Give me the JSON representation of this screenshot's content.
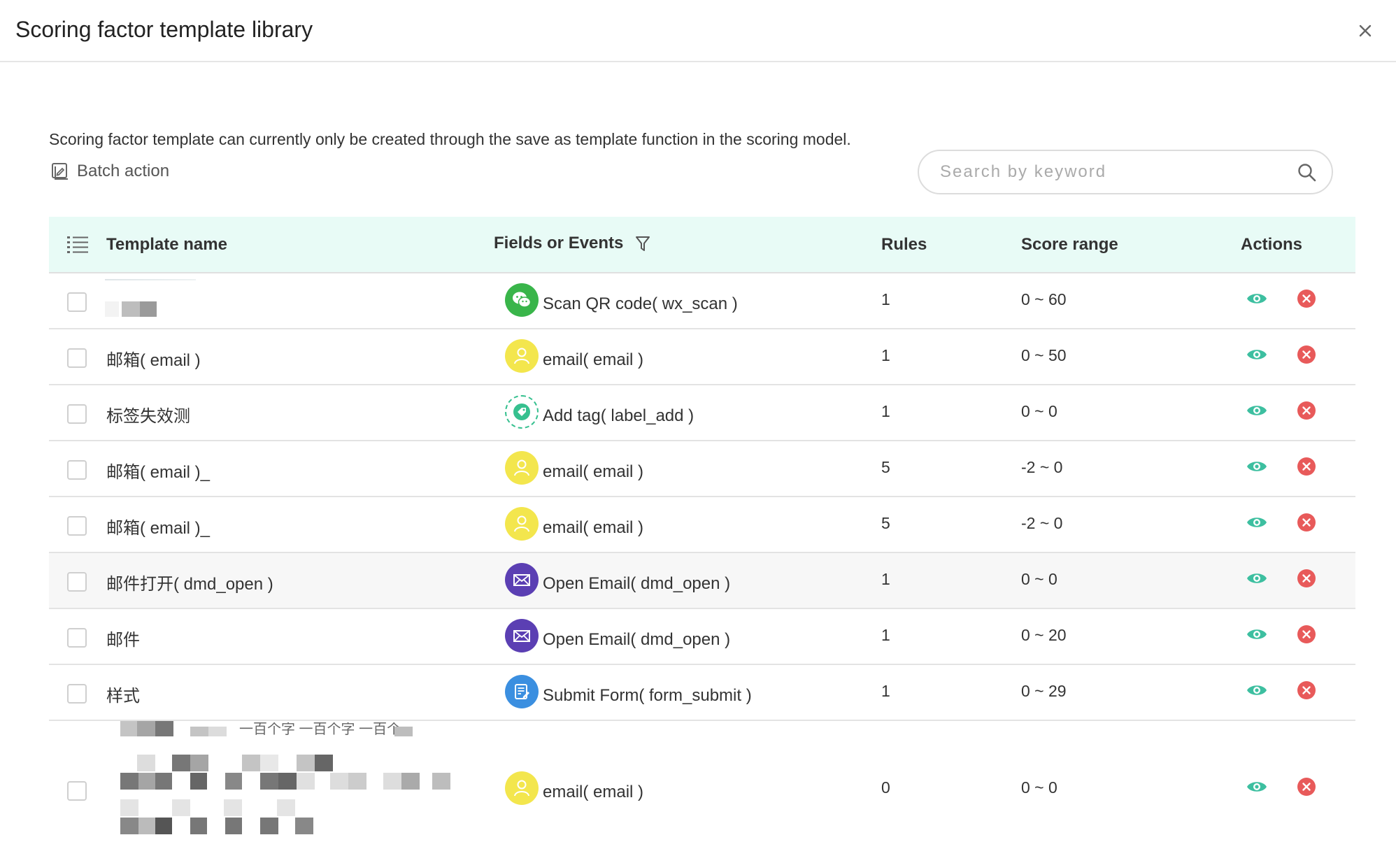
{
  "dialog": {
    "title": "Scoring factor template library",
    "notice": "Scoring factor template can currently only be created through the save as template function in the scoring model.",
    "batch_action_label": "Batch action",
    "search": {
      "placeholder": "Search by keyword",
      "value": ""
    }
  },
  "table": {
    "columns": {
      "name": "Template name",
      "fields": "Fields or Events",
      "rules": "Rules",
      "score": "Score range",
      "actions": "Actions"
    },
    "rows": [
      {
        "name": "",
        "field_icon": "wechat-icon",
        "field": "Scan QR code( wx_scan )",
        "rules": "1",
        "score": "0 ~ 60"
      },
      {
        "name": "邮箱( email )",
        "field_icon": "user-icon",
        "field": "email( email )",
        "rules": "1",
        "score": "0 ~ 50"
      },
      {
        "name": "标签失效测",
        "field_icon": "tag-icon",
        "field": "Add tag( label_add )",
        "rules": "1",
        "score": "0 ~ 0"
      },
      {
        "name": "邮箱( email )_",
        "field_icon": "user-icon",
        "field": "email( email )",
        "rules": "5",
        "score": "-2 ~ 0"
      },
      {
        "name": "邮箱( email )_",
        "field_icon": "user-icon",
        "field": "email( email )",
        "rules": "5",
        "score": "-2 ~ 0"
      },
      {
        "name": "邮件打开( dmd_open )",
        "field_icon": "mail-icon",
        "field": "Open Email( dmd_open )",
        "rules": "1",
        "score": "0 ~ 0"
      },
      {
        "name": "邮件",
        "field_icon": "mail-icon",
        "field": "Open Email( dmd_open )",
        "rules": "1",
        "score": "0 ~ 20"
      },
      {
        "name": "样式",
        "field_icon": "form-icon",
        "field": "Submit Form( form_submit )",
        "rules": "1",
        "score": "0 ~ 29"
      },
      {
        "name": "",
        "field_icon": "user-icon",
        "field": "email( email )",
        "rules": "0",
        "score": "0 ~ 0"
      }
    ],
    "partial_text_in_last_row": "一百个字 一百个字 一百个",
    "highlighted_row_index": 5
  },
  "colors": {
    "header_bg": "#e8fbf6",
    "view_icon": "#3dbfa0",
    "delete_icon": "#e85a5a",
    "wechat": "#39b54a",
    "user_icon_bg": "#f3e64d",
    "tag_icon": "#36c08f",
    "mail_icon_bg": "#5b3fb3",
    "form_icon_bg": "#3b8fe0"
  }
}
